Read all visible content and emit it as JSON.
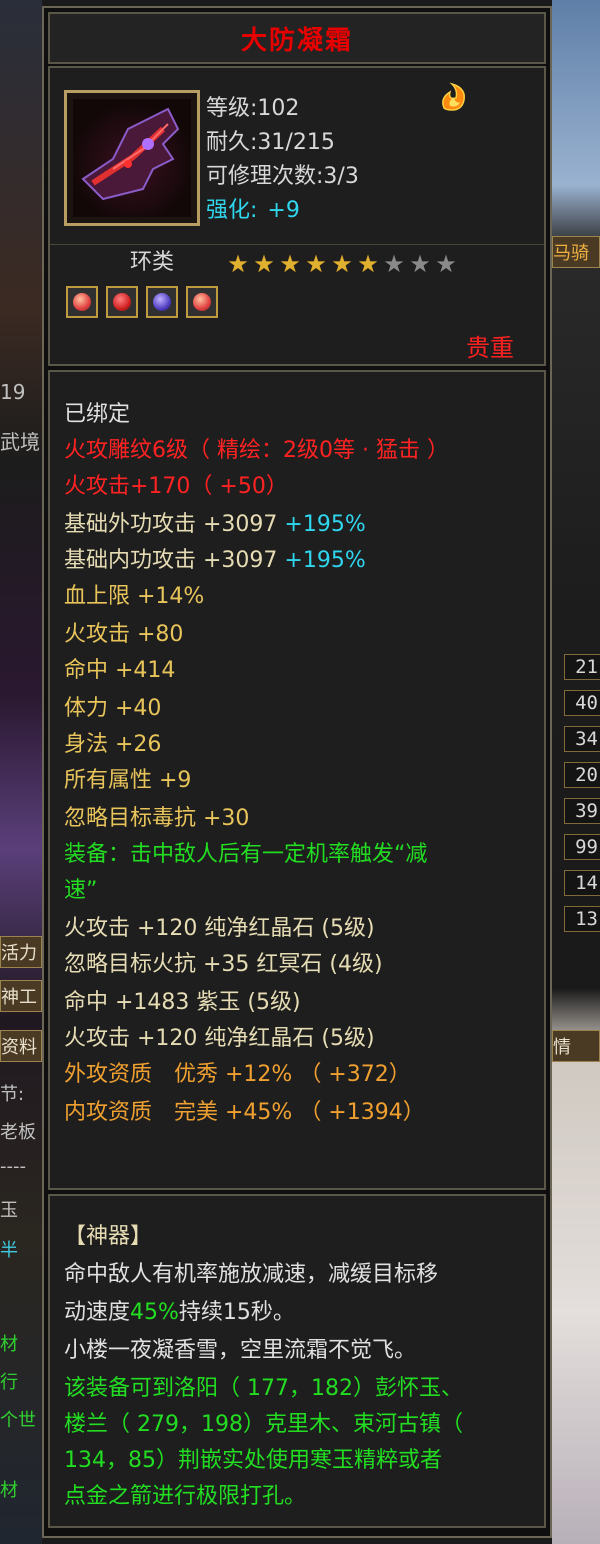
{
  "background": {
    "left_texts": [
      "19",
      "武境",
      "活力",
      "神工",
      "资料",
      "节:",
      "老板",
      "----",
      "玉",
      "半",
      "材",
      "行",
      "个世",
      "材"
    ],
    "right_texts": [
      "马骑",
      "情"
    ],
    "right_numbers": [
      "21",
      "40",
      "34",
      "20",
      "39",
      "99",
      "14",
      "13"
    ]
  },
  "item": {
    "name": "大防凝霜",
    "level": "等级:102",
    "durability": "耐久:31/215",
    "repairs": "可修理次数:3/3",
    "enhance_label": "强化:",
    "enhance_value": "+9",
    "type": "环类",
    "stars_filled": 6,
    "stars_total": 9,
    "gems": [
      "red-gem-icon",
      "red-crystal-icon",
      "purple-gem-icon",
      "red-gem-icon"
    ],
    "rarity": "贵重"
  },
  "attributes": {
    "bound": "已绑定",
    "engrave": "火攻雕纹6级（ 精绘：2级0等 · 猛击 ）",
    "fire_attack_base": "火攻击+170（ +50）",
    "base_outer_attack": "基础外功攻击 +3097",
    "base_outer_pct": "+195%",
    "base_inner_attack": "基础内功攻击 +3097",
    "base_inner_pct": "+195%",
    "hp_limit": "血上限 +14%",
    "fire_attack": "火攻击 +80",
    "hit": "命中 +414",
    "stamina": "体力 +40",
    "agility": "身法 +26",
    "all_attrs": "所有属性 +9",
    "ignore_poison": "忽略目标毒抗 +30",
    "equip_effect_1": "装备：击中敌人后有一定机率触发“减",
    "equip_effect_2": "速”",
    "gem_line_1": "火攻击 +120 纯净红晶石 (5级)",
    "gem_line_2": "忽略目标火抗 +35 红冥石 (4级)",
    "gem_line_3": "命中 +1483 紫玉 (5级)",
    "gem_line_4": "火攻击 +120 纯净红晶石 (5级)",
    "outer_quality": "外攻资质　优秀 +12% （ +372）",
    "inner_quality": "内攻资质　完美 +45% （ +1394）"
  },
  "description": {
    "header": "【神器】",
    "line1": "命中敌人有机率施放减速，减缓目标移",
    "line2_a": "动速度",
    "line2_b": "45%",
    "line2_c": "持续15秒。",
    "poem": "小楼一夜凝香雪，空里流霜不觉飞。",
    "loc1": "该装备可到洛阳（ 177，182）彭怀玉、",
    "loc2": "楼兰（ 279，198）克里木、束河古镇（",
    "loc3": "134，85）荆嵌实处使用寒玉精粹或者",
    "loc4": "点金之箭进行极限打孔。"
  },
  "colors": {
    "name_red": "#e60000",
    "cyan": "#2fd6ee",
    "yellow": "#e8c45a",
    "green": "#22dd22",
    "orange": "#f0a030",
    "beige": "#e6dcb4"
  }
}
